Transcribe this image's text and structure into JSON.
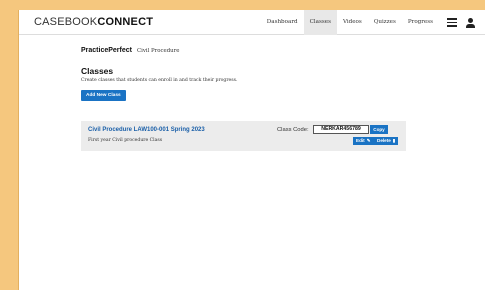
{
  "header": {
    "logo_light": "CASEBOOK",
    "logo_bold": "CONNECT",
    "nav": [
      {
        "label": "Dashboard"
      },
      {
        "label": "Classes"
      },
      {
        "label": "Videos"
      },
      {
        "label": "Quizzes"
      },
      {
        "label": "Progress"
      }
    ],
    "active_nav": "Classes",
    "icons": [
      "menu-icon",
      "user-icon"
    ]
  },
  "breadcrumb": {
    "brand": "PracticePerfect",
    "course": "Civil Procedure"
  },
  "page": {
    "title": "Classes",
    "description": "Create classes that students can enroll in and track their progress.",
    "add_button": "Add New Class"
  },
  "classes": [
    {
      "name": "Civil Procedure LAW100-001 Spring 2023",
      "description": "First year Civil procedure Class",
      "code_label": "Class Code:",
      "code": "NERKAR456789",
      "copy_label": "Copy",
      "edit_label": "Edit",
      "delete_label": "Delete"
    }
  ],
  "colors": {
    "accent": "#1a73c4",
    "title_link": "#1a5fa8",
    "background_outer": "#f5c77e",
    "card_background": "#ececec"
  }
}
